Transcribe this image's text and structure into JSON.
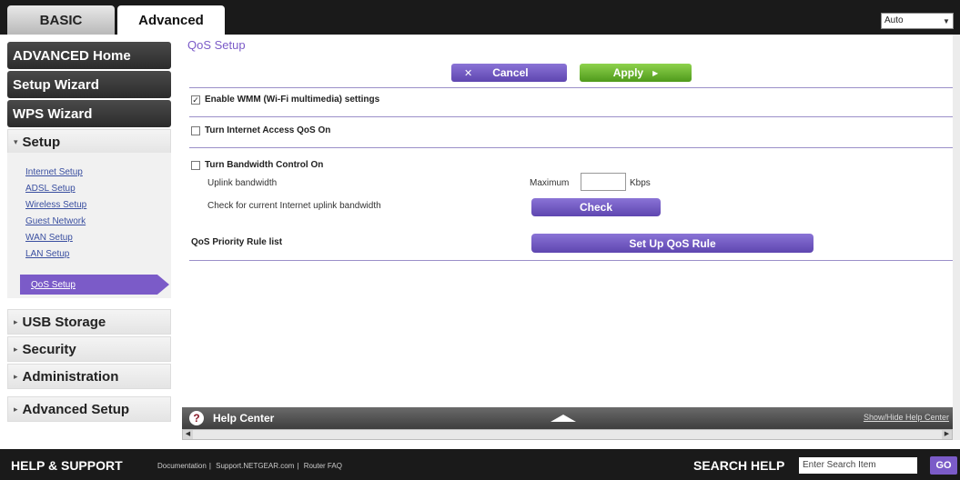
{
  "tabs": {
    "basic": "BASIC",
    "advanced": "Advanced"
  },
  "language": {
    "selected": "Auto"
  },
  "sidebar": {
    "advanced_home": "ADVANCED Home",
    "setup_wizard": "Setup Wizard",
    "wps_wizard": "WPS Wizard",
    "setup": "Setup",
    "setup_items": [
      "Internet Setup",
      "ADSL Setup",
      "Wireless Setup",
      "Guest Network",
      "WAN Setup",
      "LAN Setup"
    ],
    "active_item": "QoS Setup",
    "usb_storage": "USB Storage",
    "security": "Security",
    "administration": "Administration",
    "advanced_setup": "Advanced Setup"
  },
  "main": {
    "title": "QoS Setup",
    "cancel": "Cancel",
    "apply": "Apply",
    "wmm_label": "Enable WMM (Wi-Fi multimedia) settings",
    "wmm_checked": "✓",
    "internet_qos_label": "Turn Internet Access QoS On",
    "bandwidth_label": "Turn Bandwidth Control On",
    "uplink_label": "Uplink bandwidth",
    "maximum_label": "Maximum",
    "kbps_label": "Kbps",
    "check_label": "Check for current Internet uplink bandwidth",
    "check_button": "Check",
    "priority_label": "QoS Priority Rule list",
    "setup_rule_button": "Set Up QoS Rule"
  },
  "help": {
    "icon": "?",
    "title": "Help Center",
    "toggle": "Show/Hide Help Center"
  },
  "footer": {
    "title": "HELP & SUPPORT",
    "links": [
      "Documentation",
      "Support.NETGEAR.com",
      "Router FAQ"
    ],
    "search_label": "SEARCH HELP",
    "search_placeholder": "Enter Search Item",
    "go": "GO"
  }
}
